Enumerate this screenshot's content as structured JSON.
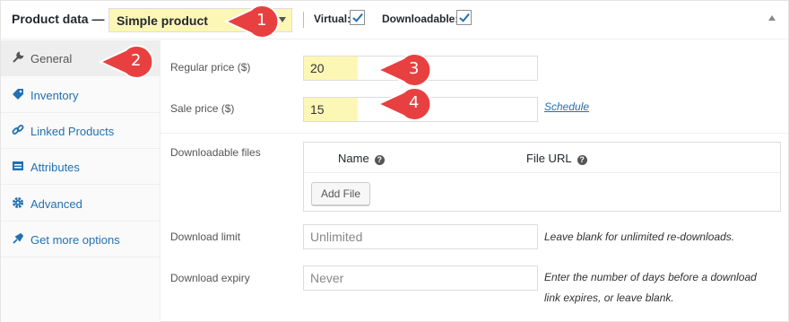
{
  "header": {
    "title": "Product data —",
    "product_type": "Simple product",
    "virtual_label": "Virtual:",
    "virtual_checked": true,
    "downloadable_label": "Downloadable:",
    "downloadable_checked": true
  },
  "sidebar": {
    "active": "General",
    "items": [
      {
        "label": "General",
        "icon": "wrench-icon"
      },
      {
        "label": "Inventory",
        "icon": "tag-icon"
      },
      {
        "label": "Linked Products",
        "icon": "link-icon"
      },
      {
        "label": "Attributes",
        "icon": "list-icon"
      },
      {
        "label": "Advanced",
        "icon": "gear-icon"
      },
      {
        "label": "Get more options",
        "icon": "plugin-icon"
      }
    ]
  },
  "general": {
    "regular_price_label": "Regular price ($)",
    "regular_price_value": "20",
    "sale_price_label": "Sale price ($)",
    "sale_price_value": "15",
    "schedule_link": "Schedule",
    "downloadable_files_label": "Downloadable files",
    "files_table": {
      "col_name": "Name",
      "col_url": "File URL",
      "add_button": "Add File"
    },
    "download_limit_label": "Download limit",
    "download_limit_placeholder": "Unlimited",
    "download_limit_hint": "Leave blank for unlimited re-downloads.",
    "download_expiry_label": "Download expiry",
    "download_expiry_placeholder": "Never",
    "download_expiry_hint_line1": "Enter the number of days before a download",
    "download_expiry_hint_line2": "link expires, or leave blank."
  },
  "callouts": [
    "1",
    "2",
    "3",
    "4"
  ],
  "colors": {
    "highlight": "#fdf7b6",
    "callout": "#e84040",
    "link": "#2271b1"
  }
}
